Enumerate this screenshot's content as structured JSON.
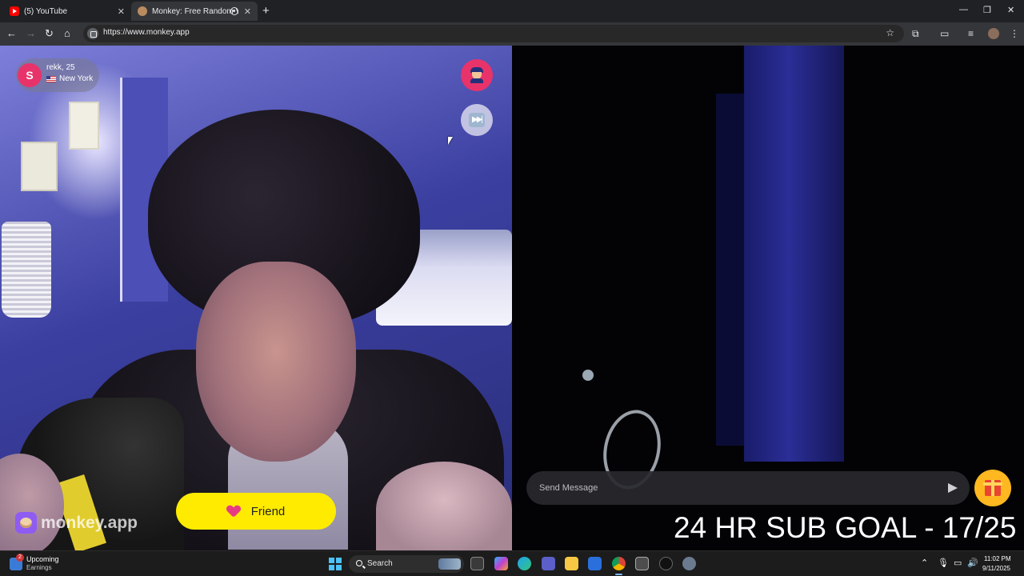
{
  "browser": {
    "tabs": [
      {
        "title": "(5) YouTube",
        "favicon": "youtube-icon",
        "active": false
      },
      {
        "title": "Monkey: Free Random Vide",
        "favicon": "monkey-icon",
        "active": true,
        "recording": true
      }
    ],
    "url": "https://www.monkey.app"
  },
  "partner": {
    "avatar_initial": "S",
    "name_age": "rekk, 25",
    "location": "New York",
    "flag": "us-flag-icon"
  },
  "controls": {
    "report_icon": "police-officer-icon",
    "skip_icon": "next-track-icon"
  },
  "brand": {
    "text": "monkey.app"
  },
  "friend_button": {
    "label": "Friend"
  },
  "chat": {
    "placeholder": "Send Message"
  },
  "overlay": {
    "goal_text": "24 HR SUB GOAL - 17/25"
  },
  "taskbar": {
    "widget_title": "Upcoming",
    "widget_subtitle": "Earnings",
    "widget_badge": "2",
    "search_label": "Search",
    "time": "11:02 PM",
    "date": "9/11/2025"
  },
  "colors": {
    "accent_pink": "#e8336a",
    "friend_yellow": "#ffeb00",
    "gift_orange": "#ffb81f"
  }
}
